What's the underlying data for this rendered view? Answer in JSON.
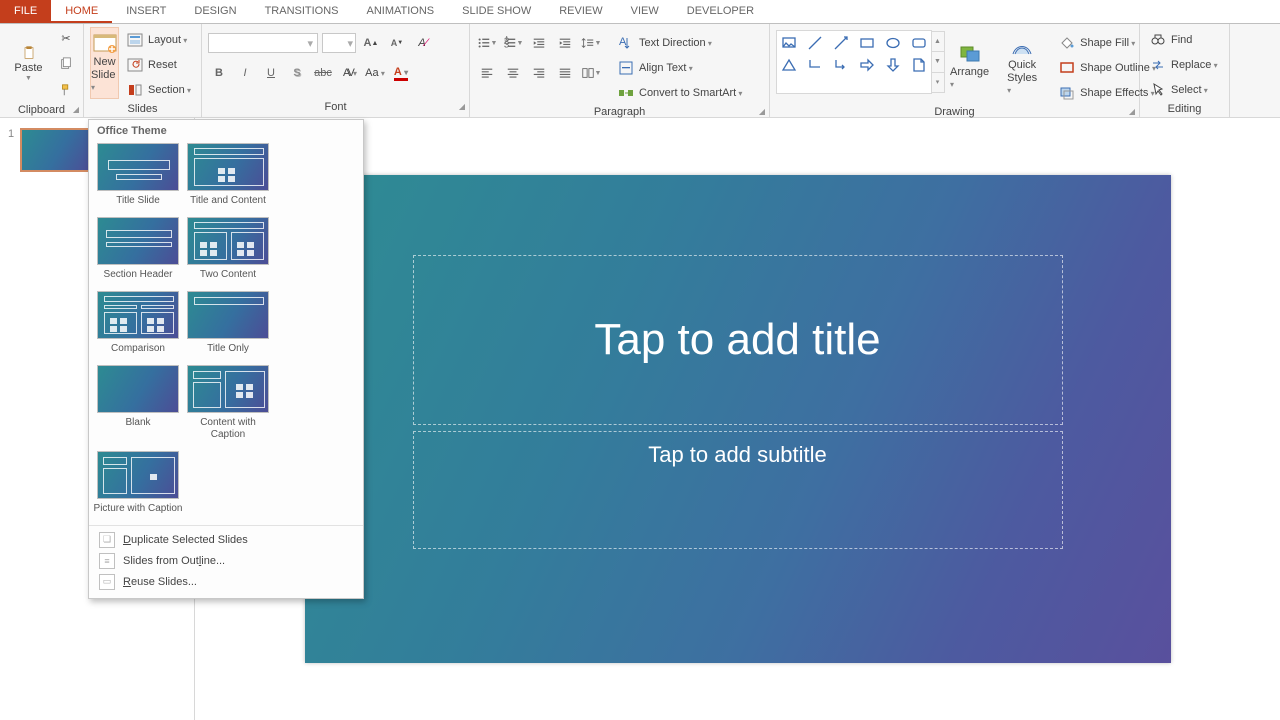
{
  "tabs": {
    "file": "FILE",
    "home": "HOME",
    "insert": "INSERT",
    "design": "DESIGN",
    "transitions": "TRANSITIONS",
    "animations": "ANIMATIONS",
    "slideshow": "SLIDE SHOW",
    "review": "REVIEW",
    "view": "VIEW",
    "developer": "DEVELOPER"
  },
  "ribbon": {
    "clipboard": {
      "paste": "Paste",
      "label": "Clipboard"
    },
    "slides": {
      "new": "New",
      "slide": "Slide",
      "layout": "Layout",
      "reset": "Reset",
      "section": "Section",
      "label": "Slides"
    },
    "font": {
      "label": "Font"
    },
    "paragraph": {
      "text_direction": "Text Direction",
      "align_text": "Align Text",
      "convert_smartart": "Convert to SmartArt",
      "label": "Paragraph"
    },
    "drawing": {
      "arrange": "Arrange",
      "quick": "Quick",
      "styles": "Styles",
      "shape_fill": "Shape Fill",
      "shape_outline": "Shape Outline",
      "shape_effects": "Shape Effects",
      "label": "Drawing"
    },
    "editing": {
      "find": "Find",
      "replace": "Replace",
      "select": "Select",
      "label": "Editing"
    }
  },
  "popup": {
    "header": "Office Theme",
    "layouts": [
      "Title Slide",
      "Title and Content",
      "Section Header",
      "Two Content",
      "Comparison",
      "Title Only",
      "Blank",
      "Content with Caption",
      "Picture with Caption"
    ],
    "menu": {
      "dup": "Duplicate Selected Slides",
      "outline": "Slides from Outline...",
      "reuse": "Reuse Slides..."
    }
  },
  "slide": {
    "title": "Tap to add title",
    "subtitle": "Tap to add subtitle"
  },
  "thumbnail": {
    "num": "1"
  }
}
